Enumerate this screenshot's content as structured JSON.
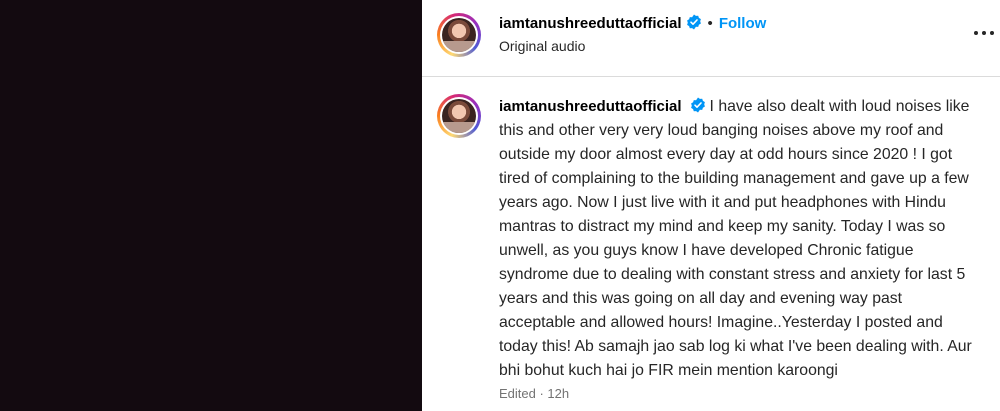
{
  "header": {
    "username": "iamtanushreeduttaofficial",
    "separator": "•",
    "follow_label": "Follow",
    "audio": "Original audio"
  },
  "comment": {
    "username": "iamtanushreeduttaofficial",
    "text": "I have also dealt with loud noises like this and other very very loud banging noises above my roof and outside my door almost every day at odd hours since 2020 ! I got tired of complaining to the building management and gave up a few years ago. Now I just live with it and put headphones with Hindu mantras to distract my mind and keep my sanity. Today I was so unwell, as you guys know I have developed Chronic fatigue syndrome due to dealing with constant stress and anxiety for last 5 years and this was going on all day and evening way past acceptable and allowed hours! Imagine..Yesterday I posted and today this! Ab samajh jao sab log ki what I've been dealing with. Aur bhi bohut kuch hai jo FIR mein mention karoongi",
    "meta": "Edited · 12h"
  },
  "colors": {
    "accent": "#0095f6",
    "media_background": "#130a10",
    "secondary_text": "#737373"
  },
  "icons": {
    "verified": "verified-badge-icon",
    "more": "more-options-icon"
  }
}
